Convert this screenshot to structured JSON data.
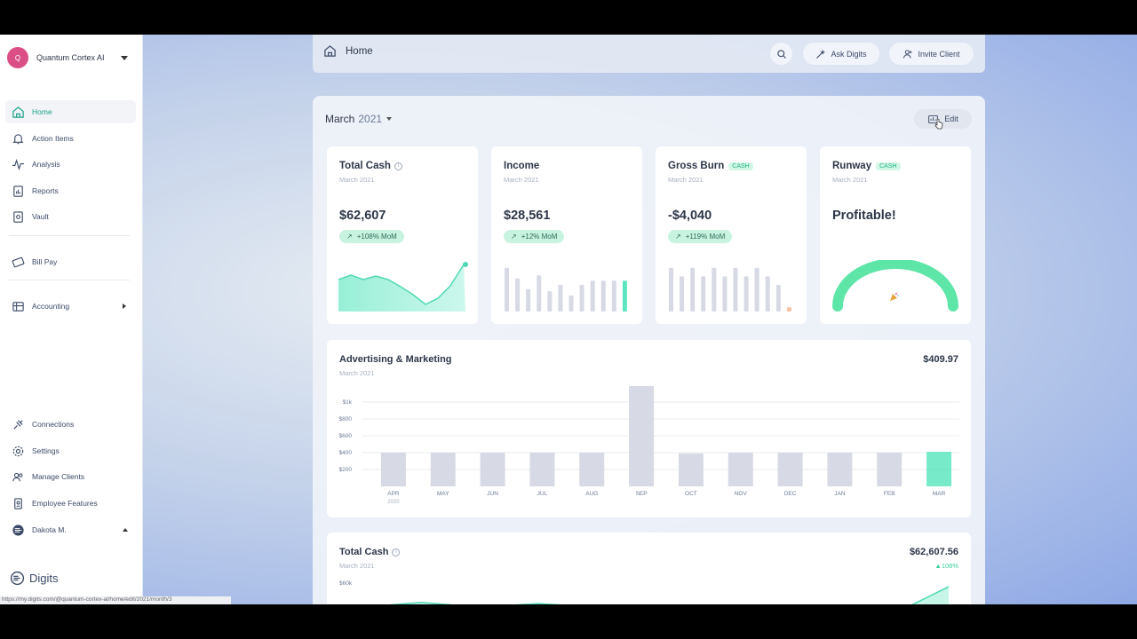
{
  "org": {
    "avatar_letter": "Q",
    "name": "Quantum Cortex AI",
    "avatar_color": "#d94f86"
  },
  "nav": {
    "home": "Home",
    "action_items": "Action Items",
    "analysis": "Analysis",
    "reports": "Reports",
    "vault": "Vault",
    "bill_pay": "Bill Pay",
    "accounting": "Accounting",
    "connections": "Connections",
    "settings": "Settings",
    "manage_clients": "Manage Clients",
    "employee_features": "Employee Features",
    "user": "Dakota M."
  },
  "brand": "Digits",
  "status_url": "https://my.digits.com/@quantum-cortex-ai/home/edit/2021/month/3",
  "topbar": {
    "title": "Home",
    "ask": "Ask Digits",
    "invite": "Invite Client"
  },
  "period": {
    "month": "March",
    "year": "2021"
  },
  "edit_label": "Edit",
  "cards": {
    "total_cash": {
      "title": "Total Cash",
      "sub": "March 2021",
      "value": "$62,607",
      "badge": "+108% MoM"
    },
    "income": {
      "title": "Income",
      "sub": "March 2021",
      "value": "$28,561",
      "badge": "+12% MoM",
      "bars": [
        0.82,
        0.62,
        0.42,
        0.68,
        0.38,
        0.5,
        0.3,
        0.5,
        0.58,
        0.58,
        0.58,
        0.58
      ]
    },
    "gross_burn": {
      "title": "Gross Burn",
      "tag": "CASH",
      "sub": "March 2021",
      "value": "-$4,040",
      "badge": "+119% MoM",
      "bars": [
        0.82,
        0.66,
        0.82,
        0.66,
        0.82,
        0.66,
        0.82,
        0.66,
        0.82,
        0.66,
        0.5,
        0.08
      ]
    },
    "runway": {
      "title": "Runway",
      "tag": "CASH",
      "sub": "March 2021",
      "value": "Profitable!"
    }
  },
  "advertising": {
    "title": "Advertising & Marketing",
    "sub": "March 2021",
    "amount": "$409.97",
    "y_ticks": [
      "$1k",
      "$800",
      "$600",
      "$400",
      "$200"
    ],
    "year_label": "2020"
  },
  "total_cash_wide": {
    "title": "Total Cash",
    "sub": "March 2021",
    "amount": "$62,607.56",
    "change": "▲108%",
    "top_tick": "$60k"
  },
  "chart_data": [
    {
      "type": "bar",
      "title": "Advertising & Marketing",
      "categories": [
        "APR",
        "MAY",
        "JUN",
        "JUL",
        "AUG",
        "SEP",
        "OCT",
        "NOV",
        "DEC",
        "JAN",
        "FEB",
        "MAR"
      ],
      "values": [
        400,
        400,
        400,
        400,
        400,
        1200,
        390,
        400,
        400,
        400,
        400,
        409.97
      ],
      "ylim": [
        0,
        1000
      ],
      "highlight_color": "#5ee6c0",
      "bar_color": "#d7dae4"
    },
    {
      "type": "area",
      "title": "Total Cash",
      "values": [
        0.6,
        0.68,
        0.6,
        0.66,
        0.6,
        0.44,
        0.28,
        0.08,
        0.22,
        0.46,
        0.94
      ],
      "color": "#5ee6c0"
    }
  ],
  "colors": {
    "accent": "#1aa389",
    "mint": "#5ee6c0",
    "gray_bar": "#d7dae4"
  }
}
